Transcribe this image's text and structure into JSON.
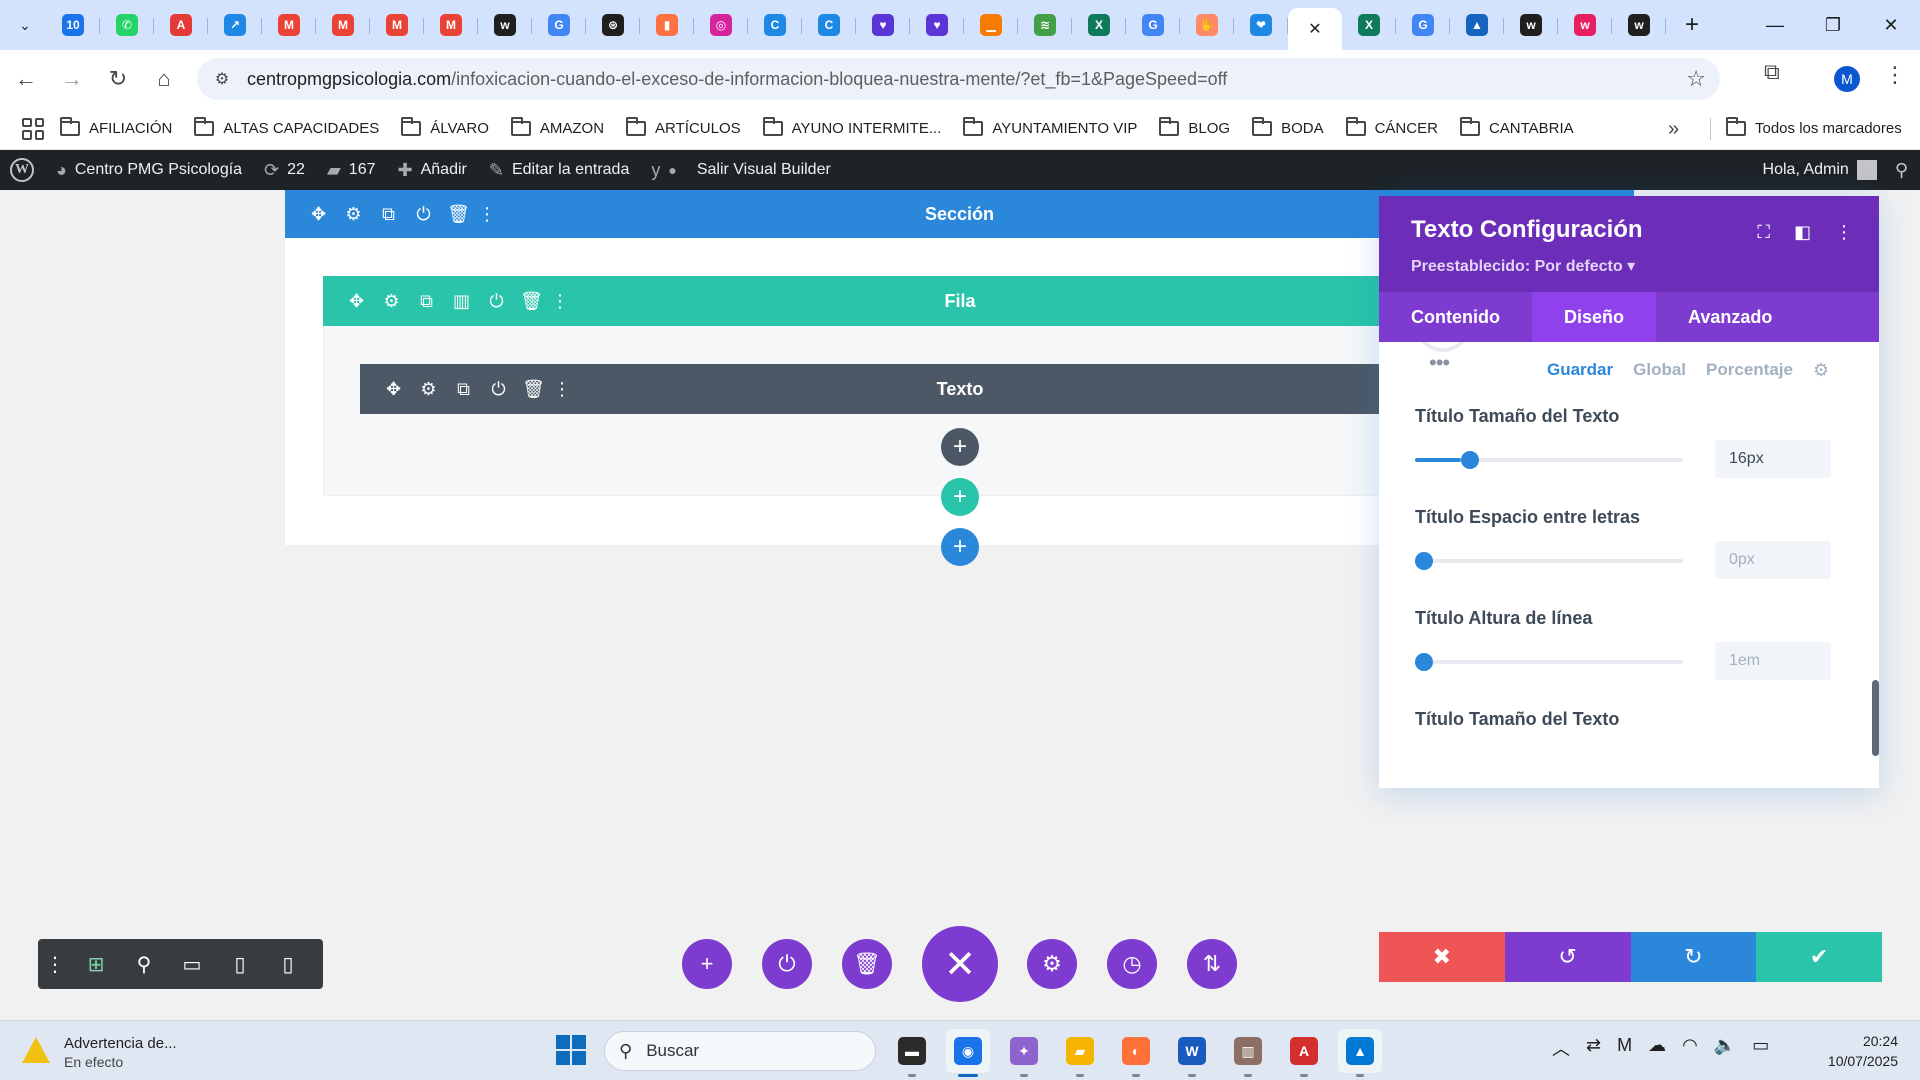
{
  "browser": {
    "tabs": [
      {
        "icon": "calendar-icon",
        "glyph": "10",
        "color": "#1a73e8"
      },
      {
        "icon": "whatsapp-icon",
        "glyph": "✆",
        "color": "#25d366"
      },
      {
        "icon": "pdf-icon",
        "glyph": "A",
        "color": "#e53935"
      },
      {
        "icon": "link-icon",
        "glyph": "↗",
        "color": "#1e88e5"
      },
      {
        "icon": "gmail-icon",
        "glyph": "M",
        "color": "#ea4335"
      },
      {
        "icon": "gmail-icon",
        "glyph": "M",
        "color": "#ea4335"
      },
      {
        "icon": "gmail-icon",
        "glyph": "M",
        "color": "#ea4335"
      },
      {
        "icon": "gmail-icon",
        "glyph": "M",
        "color": "#ea4335"
      },
      {
        "icon": "w-icon",
        "glyph": "w",
        "color": "#1f1f1f"
      },
      {
        "icon": "google-icon",
        "glyph": "G",
        "color": "#4285f4"
      },
      {
        "icon": "openai-icon",
        "glyph": "⊛",
        "color": "#1f1f1f"
      },
      {
        "icon": "orange-icon",
        "glyph": "▮",
        "color": "#ff7043"
      },
      {
        "icon": "instagram-icon",
        "glyph": "◎",
        "color": "#d6249f"
      },
      {
        "icon": "c-icon",
        "glyph": "C",
        "color": "#1e88e5"
      },
      {
        "icon": "c-icon",
        "glyph": "C",
        "color": "#1e88e5"
      },
      {
        "icon": "heart-shield-icon",
        "glyph": "♥",
        "color": "#5c35d6"
      },
      {
        "icon": "heart-shield-icon",
        "glyph": "♥",
        "color": "#5c35d6"
      },
      {
        "icon": "orange-bar-icon",
        "glyph": "▁",
        "color": "#f57c00"
      },
      {
        "icon": "chart-icon",
        "glyph": "≋",
        "color": "#43a047"
      },
      {
        "icon": "x-excel-icon",
        "glyph": "X",
        "color": "#0f7a5a"
      },
      {
        "icon": "google-icon",
        "glyph": "G",
        "color": "#4285f4"
      },
      {
        "icon": "hand-icon",
        "glyph": "✋",
        "color": "#ff8a65"
      },
      {
        "icon": "heart-hand-icon",
        "glyph": "❤",
        "color": "#1e88e5"
      },
      {
        "icon": "close-tab-icon",
        "glyph": "✕",
        "color": "#ffffff",
        "active": true
      },
      {
        "icon": "x-excel-icon",
        "glyph": "X",
        "color": "#0f7a5a"
      },
      {
        "icon": "google-icon",
        "glyph": "G",
        "color": "#4285f4"
      },
      {
        "icon": "drive-icon",
        "glyph": "▲",
        "color": "#1565c0"
      },
      {
        "icon": "w-icon",
        "glyph": "w",
        "color": "#1f1f1f"
      },
      {
        "icon": "w-pink-icon",
        "glyph": "w",
        "color": "#e91e63"
      },
      {
        "icon": "w-icon",
        "glyph": "w",
        "color": "#1f1f1f"
      }
    ],
    "url_host": "centropmgpsicologia.com",
    "url_path": "/infoxicacion-cuando-el-exceso-de-informacion-bloquea-nuestra-mente/?et_fb=1&PageSpeed=off",
    "profile_initial": "M"
  },
  "bookmarks": {
    "items": [
      "AFILIACIÓN",
      "ALTAS CAPACIDADES",
      "ÁLVARO",
      "AMAZON",
      "ARTÍCULOS",
      "AYUNO INTERMITE...",
      "AYUNTAMIENTO VIP",
      "BLOG",
      "BODA",
      "CÁNCER",
      "CANTABRIA"
    ],
    "more": "»",
    "all_label": "Todos los marcadores"
  },
  "wpbar": {
    "site_name": "Centro PMG Psicología",
    "updates_count": "22",
    "comments_count": "167",
    "add_label": "Añadir",
    "edit_label": "Editar la entrada",
    "exit_builder_label": "Salir Visual Builder",
    "greeting": "Hola, Admin"
  },
  "builder": {
    "section_label": "Sección",
    "row_label": "Fila",
    "module_label": "Texto"
  },
  "modal": {
    "title": "Texto Configuración",
    "preset": "Preestablecido: Por defecto ▾",
    "tabs": [
      {
        "label": "Contenido",
        "active": false
      },
      {
        "label": "Diseño",
        "active": true
      },
      {
        "label": "Avanzado",
        "active": false
      }
    ],
    "state_tabs": {
      "save": "Guardar",
      "global": "Global",
      "percent": "Porcentaje"
    },
    "fields": [
      {
        "label": "Título Tamaño del Texto",
        "value": "16px",
        "level": 0.17,
        "filled": true
      },
      {
        "label": "Título Espacio entre letras",
        "value": "0px",
        "level": 0.0,
        "filled": false
      },
      {
        "label": "Título Altura de línea",
        "value": "1em",
        "level": 0.0,
        "filled": false
      },
      {
        "label": "Título Tamaño del Texto",
        "value": "",
        "level": 0.0,
        "filled": false
      }
    ]
  },
  "taskbar": {
    "warning_title": "Advertencia de...",
    "warning_sub": "En efecto",
    "search_placeholder": "Buscar",
    "apps": [
      {
        "name": "file-manager-icon",
        "glyph": "▬",
        "color": "#2b2b2b",
        "running": false
      },
      {
        "name": "chrome-icon",
        "glyph": "◉",
        "color": "#1a73e8",
        "running": true,
        "sel": true
      },
      {
        "name": "copilot-icon",
        "glyph": "✦",
        "color": "#8e63ce",
        "running": false
      },
      {
        "name": "explorer-icon",
        "glyph": "▰",
        "color": "#f4b400",
        "running": false
      },
      {
        "name": "firefox-icon",
        "glyph": "◐",
        "color": "#ff7139",
        "running": false
      },
      {
        "name": "word-icon",
        "glyph": "W",
        "color": "#185abd",
        "running": false
      },
      {
        "name": "library-icon",
        "glyph": "▥",
        "color": "#8d6e63",
        "running": false
      },
      {
        "name": "acrobat-icon",
        "glyph": "A",
        "color": "#d32f2f",
        "running": false
      },
      {
        "name": "photos-icon",
        "glyph": "▲",
        "color": "#0078d4",
        "running": false,
        "sel": true
      }
    ],
    "time": "20:24",
    "date": "10/07/2025"
  }
}
